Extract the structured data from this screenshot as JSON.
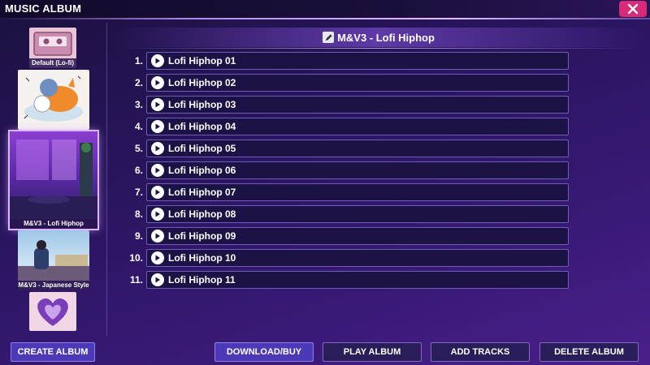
{
  "app": {
    "title": "MUSIC ALBUM"
  },
  "sidebar": {
    "albums": [
      {
        "caption": "Default (Lo-fi)"
      },
      {
        "caption": ""
      },
      {
        "caption": "M&V3 - Lofi Hiphop",
        "selected": true
      },
      {
        "caption": "M&V3 - Japanese Style"
      },
      {
        "caption": ""
      }
    ]
  },
  "header": {
    "album_name": "M&V3 - Lofi Hiphop"
  },
  "tracks": [
    {
      "num": "1.",
      "title": "Lofi Hiphop 01"
    },
    {
      "num": "2.",
      "title": "Lofi Hiphop 02"
    },
    {
      "num": "3.",
      "title": "Lofi Hiphop 03"
    },
    {
      "num": "4.",
      "title": "Lofi Hiphop 04"
    },
    {
      "num": "5.",
      "title": "Lofi Hiphop 05"
    },
    {
      "num": "6.",
      "title": "Lofi Hiphop 06"
    },
    {
      "num": "7.",
      "title": "Lofi Hiphop 07"
    },
    {
      "num": "8.",
      "title": "Lofi Hiphop 08"
    },
    {
      "num": "9.",
      "title": "Lofi Hiphop 09"
    },
    {
      "num": "10.",
      "title": "Lofi Hiphop 10"
    },
    {
      "num": "11.",
      "title": "Lofi Hiphop 11"
    }
  ],
  "buttons": {
    "create_album": "CREATE ALBUM",
    "download_buy": "DOWNLOAD/BUY",
    "play_album": "PLAY ALBUM",
    "add_tracks": "ADD TRACKS",
    "delete_album": "DELETE ALBUM"
  },
  "colors": {
    "accent": "#4b39b8",
    "close": "#d92a7a",
    "track_bg": "#1c1245",
    "track_border": "#6d5cb8"
  }
}
